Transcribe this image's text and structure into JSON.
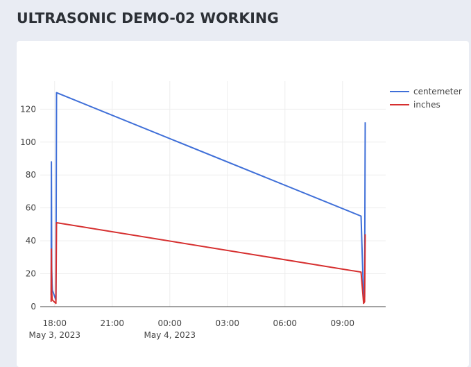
{
  "header": {
    "title": "ULTRASONIC DEMO-02 WORKING"
  },
  "chart_data": {
    "type": "line",
    "title": "",
    "xlabel": "",
    "ylabel": "",
    "x_axis_type": "date",
    "y_ticks": [
      0,
      20,
      40,
      60,
      80,
      100,
      120
    ],
    "x_ticks": [
      {
        "time": "2023-05-03T18:00",
        "label": "18:00",
        "sublabel": "May 3, 2023"
      },
      {
        "time": "2023-05-03T21:00",
        "label": "21:00",
        "sublabel": ""
      },
      {
        "time": "2023-05-04T00:00",
        "label": "00:00",
        "sublabel": "May 4, 2023"
      },
      {
        "time": "2023-05-04T03:00",
        "label": "03:00",
        "sublabel": ""
      },
      {
        "time": "2023-05-04T06:00",
        "label": "06:00",
        "sublabel": ""
      },
      {
        "time": "2023-05-04T09:00",
        "label": "09:00",
        "sublabel": ""
      }
    ],
    "xlim": [
      "2023-05-03T17:15",
      "2023-05-04T11:15"
    ],
    "ylim": [
      0,
      137
    ],
    "grid": true,
    "legend_position": "top-right",
    "series": [
      {
        "name": "centemeter",
        "color": "#3f6fd8",
        "points": [
          [
            "2023-05-03T17:49",
            7
          ],
          [
            "2023-05-03T17:50",
            88
          ],
          [
            "2023-05-03T17:51",
            23
          ],
          [
            "2023-05-03T17:52",
            14
          ],
          [
            "2023-05-03T17:53",
            10
          ],
          [
            "2023-05-03T18:04",
            4
          ],
          [
            "2023-05-03T18:06",
            130
          ],
          [
            "2023-05-04T09:58",
            55
          ],
          [
            "2023-05-04T10:06",
            4
          ],
          [
            "2023-05-04T10:09",
            6
          ],
          [
            "2023-05-04T10:11",
            112
          ]
        ]
      },
      {
        "name": "inches",
        "color": "#d62f2f",
        "points": [
          [
            "2023-05-03T17:49",
            3
          ],
          [
            "2023-05-03T17:50",
            35
          ],
          [
            "2023-05-03T17:51",
            9
          ],
          [
            "2023-05-03T17:52",
            5
          ],
          [
            "2023-05-03T17:53",
            4
          ],
          [
            "2023-05-03T18:04",
            2
          ],
          [
            "2023-05-03T18:06",
            51
          ],
          [
            "2023-05-04T09:58",
            21
          ],
          [
            "2023-05-04T10:06",
            2
          ],
          [
            "2023-05-04T10:09",
            3
          ],
          [
            "2023-05-04T10:11",
            44
          ]
        ]
      }
    ]
  }
}
